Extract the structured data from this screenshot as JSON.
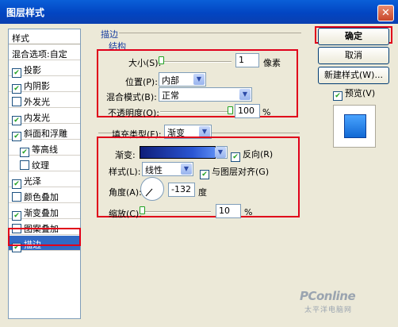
{
  "window": {
    "title": "图层样式",
    "close_glyph": "✕"
  },
  "sidebar": {
    "header": "样式",
    "blend_options": "混合选项:自定",
    "items": [
      {
        "label": "投影",
        "checked": true
      },
      {
        "label": "内阴影",
        "checked": true
      },
      {
        "label": "外发光",
        "checked": false
      },
      {
        "label": "内发光",
        "checked": true
      },
      {
        "label": "斜面和浮雕",
        "checked": true
      },
      {
        "label": "等高线",
        "checked": true
      },
      {
        "label": "纹理",
        "checked": false
      },
      {
        "label": "光泽",
        "checked": true
      },
      {
        "label": "颜色叠加",
        "checked": false
      },
      {
        "label": "渐变叠加",
        "checked": true
      },
      {
        "label": "图案叠加",
        "checked": false
      },
      {
        "label": "描边",
        "checked": true
      }
    ]
  },
  "stroke": {
    "section_title": "描边",
    "structure_title": "结构",
    "size_label": "大小(S):",
    "size_value": "1",
    "size_unit": "像素",
    "position_label": "位置(P):",
    "position_value": "内部",
    "blend_label": "混合模式(B):",
    "blend_value": "正常",
    "opacity_label": "不透明度(O):",
    "opacity_value": "100",
    "opacity_unit": "%"
  },
  "fill": {
    "fill_type_label": "填充类型(F):",
    "fill_type_value": "渐变",
    "gradient_label": "渐变:",
    "reverse_label": "反向(R)",
    "reverse_checked": true,
    "style_label": "样式(L):",
    "style_value": "线性",
    "align_label": "与图层对齐(G)",
    "align_checked": true,
    "angle_label": "角度(A):",
    "angle_value": "-132",
    "angle_unit": "度",
    "scale_label": "缩放(C):",
    "scale_value": "10",
    "scale_unit": "%"
  },
  "buttons": {
    "ok": "确定",
    "cancel": "取消",
    "new_style": "新建样式(W)...",
    "preview_label": "预览(V)",
    "preview_checked": true
  },
  "watermark": {
    "brand": "PConline",
    "sub": "太平洋电脑网"
  },
  "colors": {
    "titlebar": "#0245c2",
    "selection": "#316ac5",
    "highlight": "#e0001a",
    "gradient_start": "#0f1e7a",
    "gradient_end": "#5a8af2"
  }
}
